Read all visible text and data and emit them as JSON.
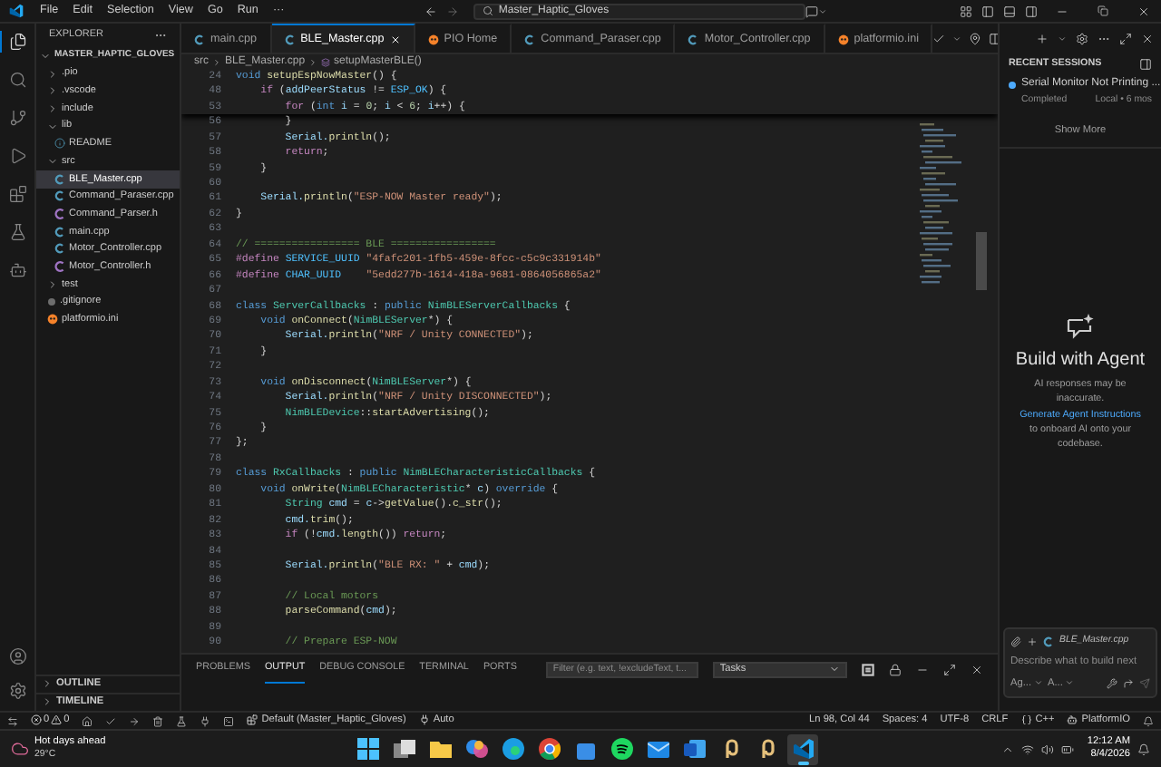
{
  "title_bar": {
    "menu": [
      "File",
      "Edit",
      "Selection",
      "View",
      "Go",
      "Run",
      "···"
    ],
    "search": "Master_Haptic_Gloves"
  },
  "activity_bar": {
    "top": [
      {
        "kind": "explorer",
        "selected": true
      },
      {
        "kind": "search",
        "selected": false
      },
      {
        "kind": "scm",
        "selected": false
      },
      {
        "kind": "debug",
        "selected": false
      },
      {
        "kind": "extensions",
        "selected": false
      },
      {
        "kind": "testing",
        "selected": false
      },
      {
        "kind": "platformio",
        "selected": false
      }
    ],
    "bottom": [
      {
        "kind": "account"
      },
      {
        "kind": "settings"
      }
    ]
  },
  "sidebar": {
    "title": "EXPLORER",
    "tree": [
      {
        "label": "MASTER_HAPTIC_GLOVES",
        "kind": "root",
        "expanded": true,
        "selected": false,
        "children": [
          {
            "label": ".pio",
            "kind": "folder",
            "expanded": false,
            "selected": false
          },
          {
            "label": ".vscode",
            "kind": "folder",
            "expanded": false,
            "selected": false
          },
          {
            "label": "include",
            "kind": "folder",
            "expanded": false,
            "selected": false
          },
          {
            "label": "lib",
            "kind": "folder",
            "expanded": true,
            "selected": false,
            "children": [
              {
                "label": "README",
                "kind": "info",
                "selected": false
              }
            ]
          },
          {
            "label": "src",
            "kind": "folder",
            "expanded": true,
            "selected": false,
            "children": [
              {
                "label": "BLE_Master.cpp",
                "kind": "cpp",
                "selected": true
              },
              {
                "label": "Command_Paraser.cpp",
                "kind": "cpp",
                "selected": false
              },
              {
                "label": "Command_Parser.h",
                "kind": "h",
                "selected": false
              },
              {
                "label": "main.cpp",
                "kind": "cpp",
                "selected": false
              },
              {
                "label": "Motor_Controller.cpp",
                "kind": "cpp",
                "selected": false
              },
              {
                "label": "Motor_Controller.h",
                "kind": "h",
                "selected": false
              }
            ]
          },
          {
            "label": "test",
            "kind": "folder",
            "expanded": false,
            "selected": false
          },
          {
            "label": ".gitignore",
            "kind": "git",
            "selected": false
          },
          {
            "label": "platformio.ini",
            "kind": "pio",
            "selected": false
          }
        ]
      }
    ],
    "sections": [
      {
        "label": "OUTLINE",
        "expanded": false
      },
      {
        "label": "TIMELINE",
        "expanded": false
      }
    ]
  },
  "tabs": [
    {
      "label": "main.cpp",
      "kind": "cpp",
      "selected": false
    },
    {
      "label": "BLE_Master.cpp",
      "kind": "cpp",
      "selected": true
    },
    {
      "label": "PIO Home",
      "kind": "pio",
      "selected": false
    },
    {
      "label": "Command_Paraser.cpp",
      "kind": "cpp",
      "selected": false
    },
    {
      "label": "Motor_Controller.cpp",
      "kind": "cpp",
      "selected": false
    },
    {
      "label": "platformio.ini",
      "kind": "pio",
      "selected": false
    }
  ],
  "breadcrumb": [
    "src",
    "BLE_Master.cpp",
    "setupMasterBLE()"
  ],
  "sticky_lines": [
    {
      "number": "24",
      "tokens": [
        {
          "text": "void",
          "kind": "kw"
        },
        {
          "text": " setupEspNowMaster",
          "kind": "fn"
        },
        {
          "text": "() {",
          "kind": "pl"
        }
      ]
    },
    {
      "number": "48",
      "tokens": [
        {
          "text": "    if",
          "kind": "ctrl"
        },
        {
          "text": " (",
          "kind": "pl"
        },
        {
          "text": "addPeerStatus",
          "kind": "var"
        },
        {
          "text": " != ",
          "kind": "pl"
        },
        {
          "text": "ESP_OK",
          "kind": "const"
        },
        {
          "text": ") {",
          "kind": "pl"
        }
      ]
    },
    {
      "number": "53",
      "tokens": [
        {
          "text": "        for",
          "kind": "ctrl"
        },
        {
          "text": " (",
          "kind": "pl"
        },
        {
          "text": "int",
          "kind": "kw"
        },
        {
          "text": " i",
          "kind": "var"
        },
        {
          "text": " = ",
          "kind": "pl"
        },
        {
          "text": "0",
          "kind": "num"
        },
        {
          "text": "; ",
          "kind": "pl"
        },
        {
          "text": "i",
          "kind": "var"
        },
        {
          "text": " < ",
          "kind": "pl"
        },
        {
          "text": "6",
          "kind": "num"
        },
        {
          "text": "; ",
          "kind": "pl"
        },
        {
          "text": "i",
          "kind": "var"
        },
        {
          "text": "++) {",
          "kind": "pl"
        }
      ]
    }
  ],
  "lines": [
    {
      "number": "56",
      "tokens": [
        {
          "text": "        }",
          "kind": "pl"
        }
      ]
    },
    {
      "number": "57",
      "tokens": [
        {
          "text": "        Serial.",
          "kind": "var"
        },
        {
          "text": "println",
          "kind": "fn"
        },
        {
          "text": "();",
          "kind": "pl"
        }
      ]
    },
    {
      "number": "58",
      "tokens": [
        {
          "text": "        return",
          "kind": "ctrl"
        },
        {
          "text": ";",
          "kind": "pl"
        }
      ]
    },
    {
      "number": "59",
      "tokens": [
        {
          "text": "    }",
          "kind": "pl"
        }
      ]
    },
    {
      "number": "60"
    },
    {
      "number": "61",
      "tokens": [
        {
          "text": "    Serial.",
          "kind": "var"
        },
        {
          "text": "println",
          "kind": "fn"
        },
        {
          "text": "(",
          "kind": "pl"
        },
        {
          "text": "\"ESP-NOW Master ready\"",
          "kind": "str"
        },
        {
          "text": ");",
          "kind": "pl"
        }
      ]
    },
    {
      "number": "62",
      "tokens": [
        {
          "text": "}",
          "kind": "pl"
        }
      ]
    },
    {
      "number": "63"
    },
    {
      "number": "64",
      "tokens": [
        {
          "text": "// ================= BLE =================",
          "kind": "com"
        }
      ]
    },
    {
      "number": "65",
      "tokens": [
        {
          "text": "#define",
          "kind": "macro"
        },
        {
          "text": " SERVICE_UUID",
          "kind": "const"
        },
        {
          "text": " \"4fafc201-1fb5-459e-8fcc-c5c9c331914b\"",
          "kind": "str"
        }
      ]
    },
    {
      "number": "66",
      "tokens": [
        {
          "text": "#define",
          "kind": "macro"
        },
        {
          "text": " CHAR_UUID",
          "kind": "const"
        },
        {
          "text": "    \"5edd277b-1614-418a-9681-0864056865a2\"",
          "kind": "str"
        }
      ]
    },
    {
      "number": "67"
    },
    {
      "number": "68",
      "tokens": [
        {
          "text": "class",
          "kind": "kw"
        },
        {
          "text": " ServerCallbacks",
          "kind": "type"
        },
        {
          "text": " : ",
          "kind": "pl"
        },
        {
          "text": "public",
          "kind": "kw"
        },
        {
          "text": " NimBLEServerCallbacks",
          "kind": "type"
        },
        {
          "text": " {",
          "kind": "pl"
        }
      ]
    },
    {
      "number": "69",
      "tokens": [
        {
          "text": "    void",
          "kind": "kw"
        },
        {
          "text": " onConnect",
          "kind": "fn"
        },
        {
          "text": "(",
          "kind": "pl"
        },
        {
          "text": "NimBLEServer",
          "kind": "type"
        },
        {
          "text": "*) {",
          "kind": "pl"
        }
      ]
    },
    {
      "number": "70",
      "tokens": [
        {
          "text": "        Serial.",
          "kind": "var"
        },
        {
          "text": "println",
          "kind": "fn"
        },
        {
          "text": "(",
          "kind": "pl"
        },
        {
          "text": "\"NRF / Unity CONNECTED\"",
          "kind": "str"
        },
        {
          "text": ");",
          "kind": "pl"
        }
      ]
    },
    {
      "number": "71",
      "tokens": [
        {
          "text": "    }",
          "kind": "pl"
        }
      ]
    },
    {
      "number": "72"
    },
    {
      "number": "73",
      "tokens": [
        {
          "text": "    void",
          "kind": "kw"
        },
        {
          "text": " onDisconnect",
          "kind": "fn"
        },
        {
          "text": "(",
          "kind": "pl"
        },
        {
          "text": "NimBLEServer",
          "kind": "type"
        },
        {
          "text": "*) {",
          "kind": "pl"
        }
      ]
    },
    {
      "number": "74",
      "tokens": [
        {
          "text": "        Serial.",
          "kind": "var"
        },
        {
          "text": "println",
          "kind": "fn"
        },
        {
          "text": "(",
          "kind": "pl"
        },
        {
          "text": "\"NRF / Unity DISCONNECTED\"",
          "kind": "str"
        },
        {
          "text": ");",
          "kind": "pl"
        }
      ]
    },
    {
      "number": "75",
      "tokens": [
        {
          "text": "        NimBLEDevice",
          "kind": "type"
        },
        {
          "text": "::",
          "kind": "pl"
        },
        {
          "text": "startAdvertising",
          "kind": "fn"
        },
        {
          "text": "();",
          "kind": "pl"
        }
      ]
    },
    {
      "number": "76",
      "tokens": [
        {
          "text": "    }",
          "kind": "pl"
        }
      ]
    },
    {
      "number": "77",
      "tokens": [
        {
          "text": "};",
          "kind": "pl"
        }
      ]
    },
    {
      "number": "78"
    },
    {
      "number": "79",
      "tokens": [
        {
          "text": "class",
          "kind": "kw"
        },
        {
          "text": " RxCallbacks",
          "kind": "type"
        },
        {
          "text": " : ",
          "kind": "pl"
        },
        {
          "text": "public",
          "kind": "kw"
        },
        {
          "text": " NimBLECharacteristicCallbacks",
          "kind": "type"
        },
        {
          "text": " {",
          "kind": "pl"
        }
      ]
    },
    {
      "number": "80",
      "tokens": [
        {
          "text": "    void",
          "kind": "kw"
        },
        {
          "text": " onWrite",
          "kind": "fn"
        },
        {
          "text": "(",
          "kind": "pl"
        },
        {
          "text": "NimBLECharacteristic",
          "kind": "type"
        },
        {
          "text": "* ",
          "kind": "pl"
        },
        {
          "text": "c",
          "kind": "var"
        },
        {
          "text": ") ",
          "kind": "pl"
        },
        {
          "text": "override",
          "kind": "kw"
        },
        {
          "text": " {",
          "kind": "pl"
        }
      ]
    },
    {
      "number": "81",
      "tokens": [
        {
          "text": "        String",
          "kind": "type"
        },
        {
          "text": " cmd",
          "kind": "var"
        },
        {
          "text": " = ",
          "kind": "pl"
        },
        {
          "text": "c",
          "kind": "var"
        },
        {
          "text": "->",
          "kind": "pl"
        },
        {
          "text": "getValue",
          "kind": "fn"
        },
        {
          "text": "().",
          "kind": "pl"
        },
        {
          "text": "c_str",
          "kind": "fn"
        },
        {
          "text": "();",
          "kind": "pl"
        }
      ]
    },
    {
      "number": "82",
      "tokens": [
        {
          "text": "        cmd.",
          "kind": "var"
        },
        {
          "text": "trim",
          "kind": "fn"
        },
        {
          "text": "();",
          "kind": "pl"
        }
      ]
    },
    {
      "number": "83",
      "tokens": [
        {
          "text": "        if",
          "kind": "ctrl"
        },
        {
          "text": " (!",
          "kind": "pl"
        },
        {
          "text": "cmd.",
          "kind": "var"
        },
        {
          "text": "length",
          "kind": "fn"
        },
        {
          "text": "()) ",
          "kind": "pl"
        },
        {
          "text": "return",
          "kind": "ctrl"
        },
        {
          "text": ";",
          "kind": "pl"
        }
      ]
    },
    {
      "number": "84"
    },
    {
      "number": "85",
      "tokens": [
        {
          "text": "        Serial.",
          "kind": "var"
        },
        {
          "text": "println",
          "kind": "fn"
        },
        {
          "text": "(",
          "kind": "pl"
        },
        {
          "text": "\"BLE RX: \"",
          "kind": "str"
        },
        {
          "text": " + ",
          "kind": "pl"
        },
        {
          "text": "cmd",
          "kind": "var"
        },
        {
          "text": ");",
          "kind": "pl"
        }
      ]
    },
    {
      "number": "86"
    },
    {
      "number": "87",
      "tokens": [
        {
          "text": "        // Local motors",
          "kind": "com"
        }
      ]
    },
    {
      "number": "88",
      "tokens": [
        {
          "text": "        parseCommand",
          "kind": "fn"
        },
        {
          "text": "(",
          "kind": "pl"
        },
        {
          "text": "cmd",
          "kind": "var"
        },
        {
          "text": ");",
          "kind": "pl"
        }
      ]
    },
    {
      "number": "89"
    },
    {
      "number": "90",
      "tokens": [
        {
          "text": "        // Prepare ESP-NOW",
          "kind": "com"
        }
      ]
    }
  ],
  "panel": {
    "tabs": [
      {
        "label": "PROBLEMS",
        "selected": false
      },
      {
        "label": "OUTPUT",
        "selected": true
      },
      {
        "label": "DEBUG CONSOLE",
        "selected": false
      },
      {
        "label": "TERMINAL",
        "selected": false
      },
      {
        "label": "PORTS",
        "selected": false
      }
    ],
    "filter": {
      "placeholder": "Filter (e.g. text, !excludeText, t..."
    },
    "channel": "Tasks"
  },
  "chat": {
    "sessions_title": "RECENT SESSIONS",
    "sessions": [
      {
        "title": "Serial Monitor Not Printing ...",
        "status": "Completed",
        "meta": "Local • 6 mos"
      }
    ],
    "show_more": "Show More",
    "heading": "Build with Agent",
    "disclaimer": "AI responses may be inaccurate.",
    "link": "Generate Agent Instructions",
    "link_rest": "to onboard AI onto your codebase.",
    "input": {
      "attachment": "BLE_Master.cpp",
      "placeholder": "Describe what to build next",
      "agent": "Ag...",
      "model": "A..."
    }
  },
  "status_bar": {
    "errors": "0",
    "warnings": "0",
    "environment": "Default (Master_Haptic_Gloves)",
    "port": "Auto",
    "right": [
      {
        "text": "Ln 98, Col 44",
        "kind": "plain"
      },
      {
        "text": "Spaces: 4",
        "kind": "plain"
      },
      {
        "text": "UTF-8",
        "kind": "plain"
      },
      {
        "text": "CRLF",
        "kind": "plain"
      },
      {
        "text": "C++",
        "kind": "language"
      },
      {
        "text": "PlatformIO",
        "kind": "platformio"
      },
      {
        "kind": "bell"
      }
    ]
  },
  "taskbar": {
    "weather": {
      "title": "Hot days ahead",
      "temp": "29°C"
    },
    "apps": [
      {
        "kind": "start",
        "selected": false
      },
      {
        "kind": "taskview",
        "selected": false
      },
      {
        "kind": "folder",
        "selected": false
      },
      {
        "kind": "blob",
        "selected": false
      },
      {
        "kind": "wave",
        "selected": false
      },
      {
        "kind": "ring",
        "selected": false
      },
      {
        "kind": "store",
        "selected": false
      },
      {
        "kind": "music",
        "selected": false
      },
      {
        "kind": "mail",
        "selected": false
      },
      {
        "kind": "doc",
        "selected": false
      },
      {
        "kind": "hook",
        "selected": false
      },
      {
        "kind": "hook",
        "selected": false
      },
      {
        "kind": "code",
        "selected": true
      }
    ],
    "time": "12:12 AM",
    "date": "8/4/2026"
  }
}
